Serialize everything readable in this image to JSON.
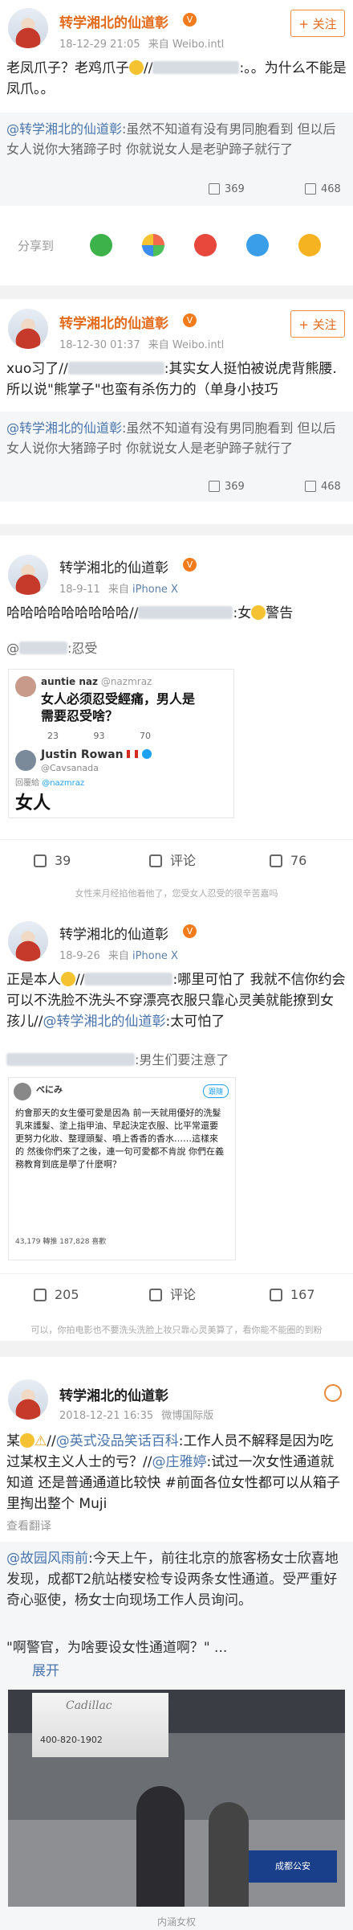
{
  "posts": [
    {
      "user": "转学湘北的仙道彰",
      "badge": "V",
      "time": "18-12-29 21:05",
      "source_prefix": "来自",
      "source": "Weibo.intl",
      "follow": "+ 关注",
      "text_a": "老凤爪子？老鸡爪子",
      "text_b": "//",
      "text_c": ":。。为什么不能是凤爪。。",
      "ref_user": "@转学湘北的仙道彰",
      "ref_text": ":虽然不知道有没有男同胞看到 但以后女人说你大猪蹄子时 你就说女人是老驴蹄子就行了",
      "repost_count": "369",
      "like_count": "468",
      "share_label": "分享到"
    },
    {
      "user": "转学湘北的仙道彰",
      "badge": "V",
      "time": "18-12-30 01:37",
      "source_prefix": "来自",
      "source": "Weibo.intl",
      "follow": "+ 关注",
      "text_a": "xuo习了//",
      "text_b": ":其实女人挺怕被说虎背熊腰. 所以说\"熊掌子\"也蛮有杀伤力的（单身小技巧",
      "ref_user": "@转学湘北的仙道彰",
      "ref_text": ":虽然不知道有没有男同胞看到 但以后女人说你大猪蹄子时 你就说女人是老驴蹄子就行了",
      "repost_count": "369",
      "like_count": "468"
    },
    {
      "user": "转学湘北的仙道彰",
      "badge": "V",
      "time": "18-9-11",
      "source_prefix": "来自",
      "source": "iPhone X",
      "text_a": "哈哈哈哈哈哈哈哈哈//",
      "text_b": ":女",
      "text_c": "警告",
      "ref_prefix": "@",
      "ref_text": ":忍受",
      "tw1_name": "auntie naz",
      "tw1_handle": "@nazmraz",
      "tw1_text": "女人必须忍受經痛，男人是需要忍受啥？",
      "tw1_stats": [
        "23",
        "93",
        "70"
      ],
      "tw2_name": "Justin Rowan",
      "tw2_handle": "@Cavsanada",
      "tw2_reply_prefix": "回覆給",
      "tw2_reply_handle": "@nazmraz",
      "tw2_text": "女人",
      "repost_count": "39",
      "comment_label": "评论",
      "like_count": "76",
      "notice": "女性来月经掐他着他了，您受女人忍受的很辛苦嘉吗"
    },
    {
      "user": "转学湘北的仙道彰",
      "badge": "V",
      "time": "18-9-26",
      "source_prefix": "来自",
      "source": "iPhone X",
      "text_a": "正是本人",
      "text_b": "//",
      "text_c": ":哪里可怕了 我就不信你约会可以不洗脸不洗头不穿漂亮衣服只靠心灵美就能撩到女孩儿//",
      "text_link": "@转学湘北的仙道彰",
      "text_d": ":太可怕了",
      "ref_text": ":男生们要注意了",
      "tw_name": "べにみ",
      "tw_follow": "跟隨",
      "tw_text": "約會那天的女生優可愛是因為 前一天就用優好的洗髮乳來護髮、塗上指甲油、早起決定衣服、比平常還要更努力化妝、整理頭髮、噴上香香的香水……這樣來的 然後你們來了之後，連一句可愛都不肯說 你們在義務教育到底是學了什麼啊？",
      "tw_stats": "43,179 轉推  187,828 喜歡",
      "repost_count": "205",
      "comment_label": "评论",
      "like_count": "167",
      "notice": "可以，你拍电影也不要洗头洗脸上妆只靠心灵美算了，看你能不能圈的到粉"
    },
    {
      "user": "转学湘北的仙道彰",
      "time": "2018-12-21 16:35",
      "source": "微博国际版",
      "text_a": "某",
      "text_b": "//",
      "text_link1": "@英式没品笑话百科",
      "text_c": ":工作人员不解释是因为吃过某权主义人士的亏？//",
      "text_link2": "@庄雅婷",
      "text_d": ":试过一次女性通道就知道 还是普通通道比较快 #前面各位女性都可以从箱子里掏出整个 Muji",
      "translate": "查看翻译",
      "ref_user": "@故园风雨前",
      "ref_text": ":今天上午，前往北京的旅客杨女士欣喜地发现，成都T2航站楼安检专设两条女性通道。受严重好奇心驱使，杨女士向现场工作人员询问。",
      "quote": "\"啊警官，为啥要设女性通道啊？\"",
      "quote_tail": "...",
      "expand": "展开",
      "photo_sign": "Cadillac",
      "photo_phone": "400-820-1902",
      "photo_sign2": "成都公安",
      "caption": "内涵女权"
    }
  ]
}
